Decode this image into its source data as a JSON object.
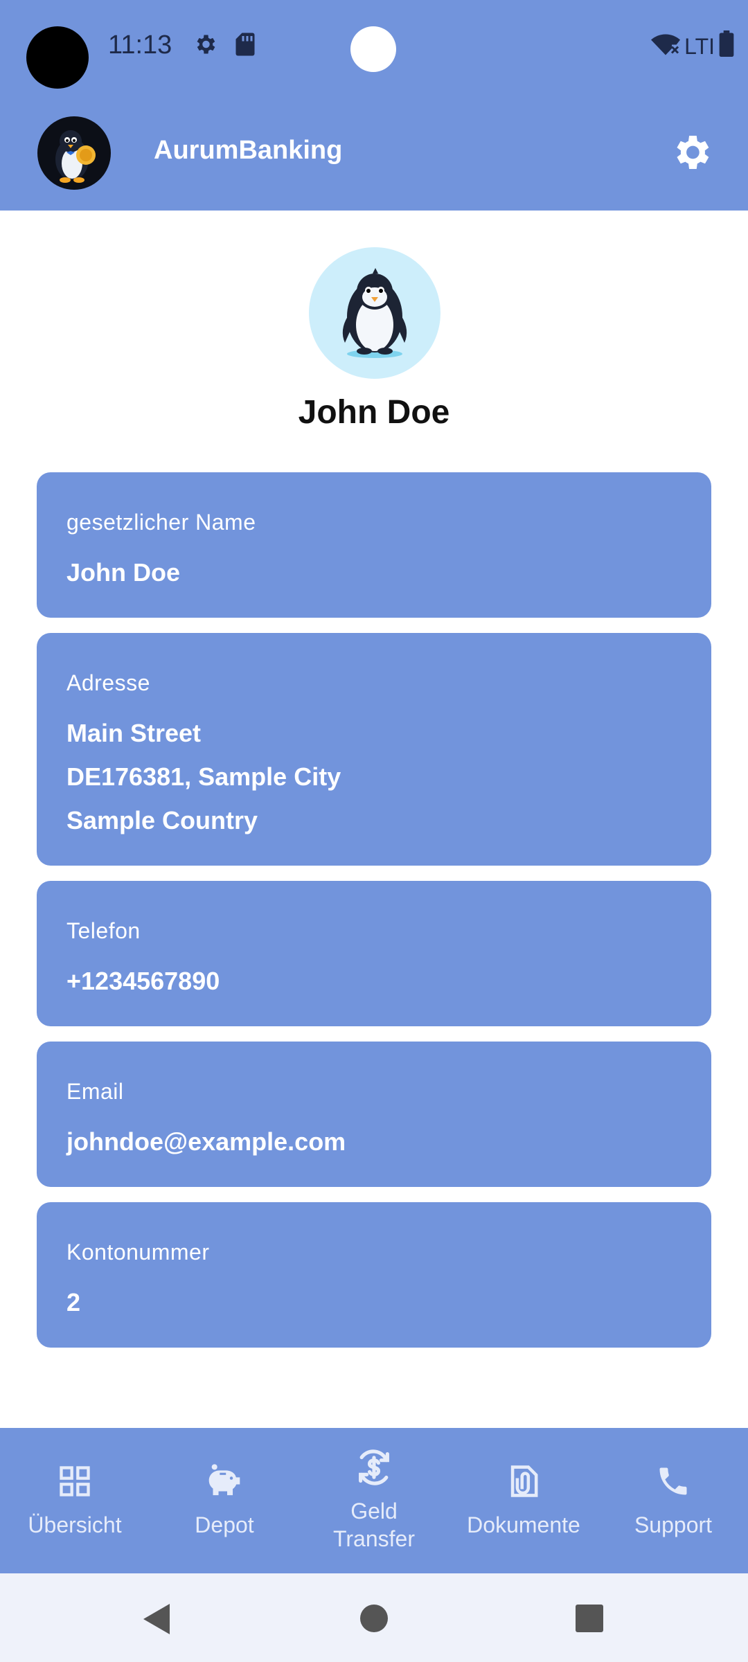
{
  "status_bar": {
    "time": "11:13",
    "network_label": "LTI"
  },
  "app_bar": {
    "title": "AurumBanking"
  },
  "profile": {
    "name": "John Doe"
  },
  "cards": [
    {
      "label": "gesetzlicher Name",
      "lines": [
        "John Doe"
      ]
    },
    {
      "label": "Adresse",
      "lines": [
        "Main Street",
        "DE176381, Sample City",
        "Sample Country"
      ]
    },
    {
      "label": "Telefon",
      "lines": [
        "+1234567890"
      ]
    },
    {
      "label": "Email",
      "lines": [
        "johndoe@example.com"
      ]
    },
    {
      "label": "Kontonummer",
      "lines": [
        "2"
      ]
    }
  ],
  "bottom_nav": {
    "items": [
      {
        "label": "Übersicht",
        "icon": "grid-icon"
      },
      {
        "label": "Depot",
        "icon": "piggy-bank-icon"
      },
      {
        "label": "Geld\nTransfer",
        "icon": "money-transfer-icon"
      },
      {
        "label": "Dokumente",
        "icon": "attachment-icon"
      },
      {
        "label": "Support",
        "icon": "phone-icon"
      }
    ]
  },
  "colors": {
    "primary": "#7294dc",
    "text_on_primary": "#ffffff",
    "system_nav_bg": "#eff2fa"
  }
}
